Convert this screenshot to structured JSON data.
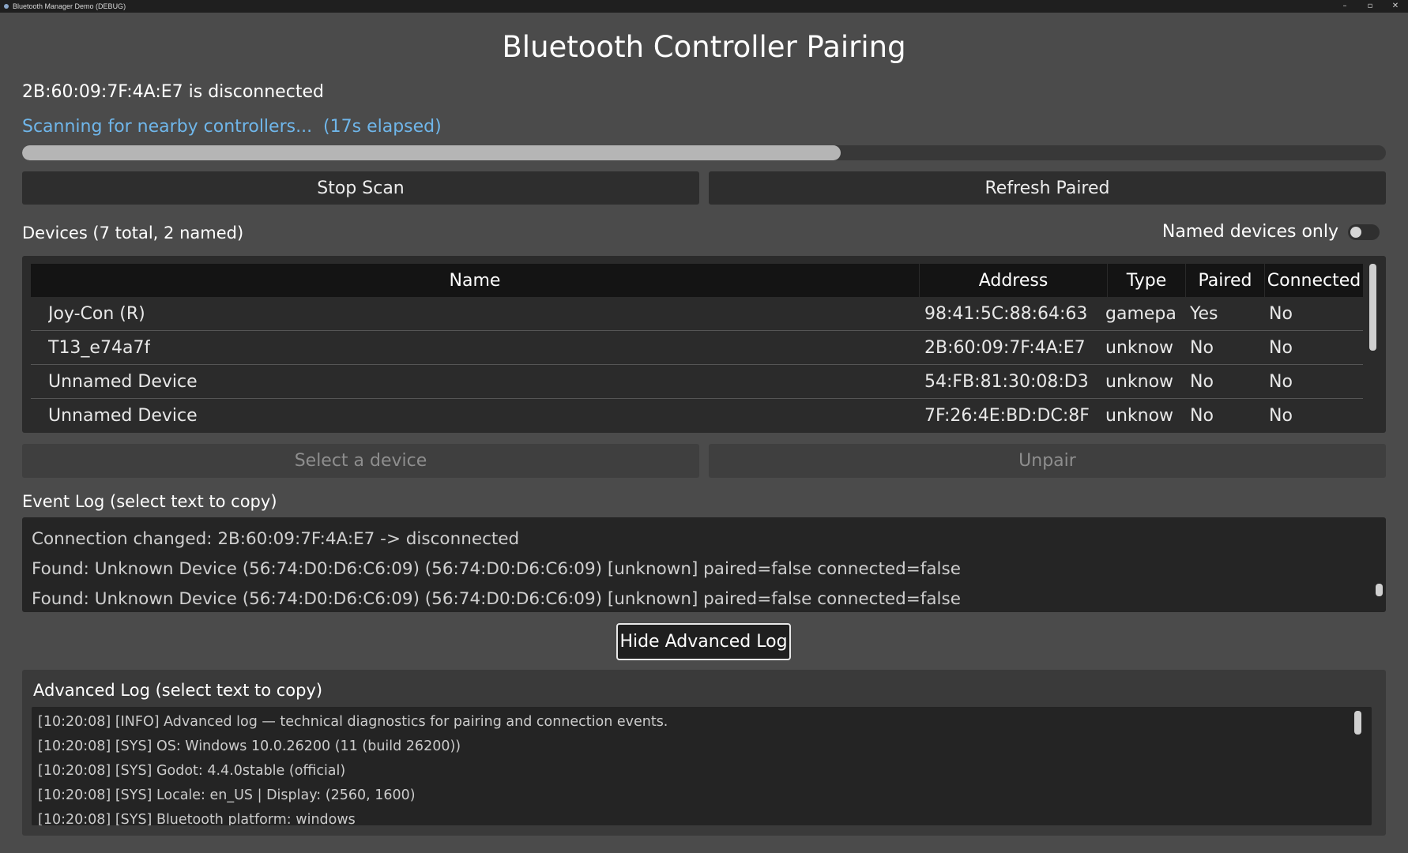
{
  "window": {
    "title": "Bluetooth Manager Demo (DEBUG)",
    "controls": [
      "–",
      "▫",
      "✕"
    ]
  },
  "page_title": "Bluetooth Controller Pairing",
  "status_text": "2B:60:09:7F:4A:E7 is disconnected",
  "scan": {
    "text": "Scanning for nearby controllers...  (17s elapsed)",
    "progress": 0.6
  },
  "buttons": {
    "stop_scan": "Stop Scan",
    "refresh_paired": "Refresh Paired",
    "select_device": "Select a device",
    "unpair": "Unpair",
    "hide_advanced_log": "Hide Advanced Log"
  },
  "devices": {
    "label": "Devices (7 total, 2 named)",
    "filter_label": "Named devices only",
    "filter_on": false,
    "columns": [
      "Name",
      "Address",
      "Type",
      "Paired",
      "Connected"
    ],
    "rows": [
      {
        "name": "Joy-Con (R)",
        "address": "98:41:5C:88:64:63",
        "type": "gamepa",
        "paired": "Yes",
        "connected": "No"
      },
      {
        "name": "T13_e74a7f",
        "address": "2B:60:09:7F:4A:E7",
        "type": "unknow",
        "paired": "No",
        "connected": "No"
      },
      {
        "name": "Unnamed Device",
        "address": "54:FB:81:30:08:D3",
        "type": "unknow",
        "paired": "No",
        "connected": "No"
      },
      {
        "name": "Unnamed Device",
        "address": "7F:26:4E:BD:DC:8F",
        "type": "unknow",
        "paired": "No",
        "connected": "No"
      }
    ]
  },
  "event_log": {
    "label": "Event Log (select text to copy)",
    "lines": [
      "Connection changed: 2B:60:09:7F:4A:E7 -> disconnected",
      "Found: Unknown Device (56:74:D0:D6:C6:09) (56:74:D0:D6:C6:09) [unknown] paired=false connected=false",
      "Found: Unknown Device (56:74:D0:D6:C6:09) (56:74:D0:D6:C6:09) [unknown] paired=false connected=false"
    ]
  },
  "advanced_log": {
    "label": "Advanced Log (select text to copy)",
    "lines": [
      "[10:20:08] [INFO] Advanced log — technical diagnostics for pairing and connection events.",
      "[10:20:08] [SYS] OS: Windows 10.0.26200 (11 (build 26200))",
      "[10:20:08] [SYS] Godot: 4.4.0stable (official)",
      "[10:20:08] [SYS] Locale: en_US | Display: (2560, 1600)",
      "[10:20:08] [SYS] Bluetooth platform: windows"
    ]
  }
}
